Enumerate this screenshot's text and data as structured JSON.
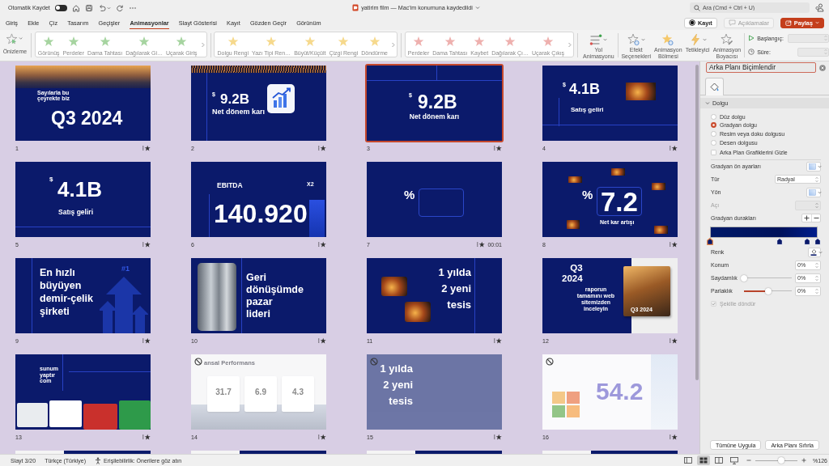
{
  "title_bar": {
    "autosave_label": "Otomatik Kaydet",
    "autosave_on": false,
    "document_title": "yatirim film — Mac'im konumuna kaydedildi",
    "search": {
      "placeholder": "Ara (Cmd + Ctrl + U)"
    }
  },
  "tabs": [
    {
      "label": "Giriş",
      "selected": false
    },
    {
      "label": "Ekle",
      "selected": false
    },
    {
      "label": "Çiz",
      "selected": false
    },
    {
      "label": "Tasarım",
      "selected": false
    },
    {
      "label": "Geçişler",
      "selected": false
    },
    {
      "label": "Animasyonlar",
      "selected": true
    },
    {
      "label": "Slayt Gösterisi",
      "selected": false
    },
    {
      "label": "Kayıt",
      "selected": false
    },
    {
      "label": "Gözden Geçir",
      "selected": false
    },
    {
      "label": "Görünüm",
      "selected": false
    }
  ],
  "header_buttons": [
    {
      "kind": "record",
      "label": "Kayıt",
      "disabled": false
    },
    {
      "kind": "comments",
      "label": "Açıklamalar",
      "disabled": true
    },
    {
      "kind": "share",
      "label": "Paylaş",
      "disabled": false
    }
  ],
  "ribbon": {
    "preview": {
      "label": "Önizleme"
    },
    "galleries": [
      {
        "kind": "entrance",
        "disabled": true,
        "items": [
          "Görünüş",
          "Perdeler",
          "Dama Tahtası",
          "Dağılarak Gi…",
          "Uçarak Giriş"
        ]
      },
      {
        "kind": "emphasis",
        "disabled": true,
        "items": [
          "Dolgu Rengi",
          "Yazı Tipi Ren…",
          "Büyüt/Küçült",
          "Çizgi Rengi",
          "Döndürme"
        ]
      },
      {
        "kind": "exit",
        "disabled": true,
        "items": [
          "Perdeler",
          "Dama Tahtası",
          "Kaybet",
          "Dağılarak Çı…",
          "Uçarak Çıkış"
        ]
      }
    ],
    "tools": [
      {
        "kind": "path",
        "label": "Yol Animasyonu",
        "has_menu": true
      },
      {
        "kind": "effects",
        "label": "Efekt Seçenekleri",
        "has_menu": true
      },
      {
        "kind": "pane",
        "label": "Animasyon Bölmesi",
        "has_menu": false
      },
      {
        "kind": "trigger",
        "label": "Tetikleyici",
        "has_menu": true
      },
      {
        "kind": "painter",
        "label": "Animasyon Boyacısı",
        "has_menu": false
      }
    ],
    "timing": [
      {
        "kind": "start",
        "label": "Başlangıç:"
      },
      {
        "kind": "duration",
        "label": "Süre:"
      }
    ]
  },
  "slides": [
    {
      "number": "1",
      "kind": "cover",
      "selected": false,
      "hidden": false,
      "animated": true,
      "subtitle": "Sayılarla bu çeyrekte biz",
      "title": "Q3 2024"
    },
    {
      "number": "2",
      "kind": "stat-image",
      "selected": false,
      "hidden": false,
      "animated": true,
      "currency": "$",
      "value": "9.2B",
      "caption": "Net dönem karı"
    },
    {
      "number": "3",
      "kind": "stat-center",
      "selected": true,
      "hidden": false,
      "animated": true,
      "currency": "$",
      "value": "9.2B",
      "caption": "Net dönem karı"
    },
    {
      "number": "4",
      "kind": "stat-photo",
      "selected": false,
      "hidden": false,
      "animated": true,
      "currency": "$",
      "value": "4.1B",
      "caption": "Satış geliri"
    },
    {
      "number": "5",
      "kind": "stat-large",
      "selected": false,
      "hidden": false,
      "animated": true,
      "currency": "$",
      "value": "4.1B",
      "caption": "Satış geliri"
    },
    {
      "number": "6",
      "kind": "ebitda",
      "selected": false,
      "hidden": false,
      "animated": true,
      "label": "EBITDA",
      "value": "140.920",
      "badge": "X2"
    },
    {
      "number": "7",
      "kind": "percent-blank",
      "selected": false,
      "hidden": false,
      "animated": true,
      "symbol": "%",
      "timing": "00:01"
    },
    {
      "number": "8",
      "kind": "percent",
      "selected": false,
      "hidden": false,
      "animated": true,
      "symbol": "%",
      "value": "7.2",
      "caption": "Net kar artışı"
    },
    {
      "number": "9",
      "kind": "headline-arrows",
      "selected": false,
      "hidden": false,
      "animated": true,
      "title": "En hızlı büyüyen demir-çelik şirketi",
      "badge": "#1"
    },
    {
      "number": "10",
      "kind": "headline-photo",
      "selected": false,
      "hidden": false,
      "animated": true,
      "title": "Geri dönüşümde pazar lideri"
    },
    {
      "number": "11",
      "kind": "facilities",
      "selected": false,
      "hidden": false,
      "animated": true,
      "title": "1 yılda 2 yeni tesis"
    },
    {
      "number": "12",
      "kind": "report",
      "selected": false,
      "hidden": false,
      "animated": true,
      "title": "Q3 2024",
      "text": "raporun tamamını web sitemizden inceleyin",
      "cover_title": "Q3 2024"
    },
    {
      "number": "13",
      "kind": "contact",
      "selected": false,
      "hidden": false,
      "animated": true,
      "logo": "sunum yaptır com"
    },
    {
      "number": "14",
      "kind": "performance",
      "selected": false,
      "hidden": true,
      "animated": true,
      "title": "ansal Performans",
      "cards": [
        "31.7",
        "6.9",
        "4.3"
      ]
    },
    {
      "number": "15",
      "kind": "facilities-plain",
      "selected": false,
      "hidden": true,
      "animated": true,
      "title": "1 yılda 2 yeni tesis"
    },
    {
      "number": "16",
      "kind": "sustainability",
      "selected": false,
      "hidden": true,
      "animated": true,
      "value": "54.2"
    },
    {
      "kind": "split"
    },
    {
      "kind": "split"
    },
    {
      "kind": "split"
    },
    {
      "kind": "split"
    }
  ],
  "format_pane": {
    "title": "Arka Planı Biçimlendir",
    "tabs": [
      {
        "kind": "fill",
        "selected": true
      }
    ],
    "section": {
      "label": "Dolgu",
      "expanded": true
    },
    "fill_options": [
      {
        "label": "Düz dolgu",
        "selected": false
      },
      {
        "label": "Gradyan dolgu",
        "selected": true
      },
      {
        "label": "Resim veya doku dolgusu",
        "selected": false
      },
      {
        "label": "Desen dolgusu",
        "selected": false
      }
    ],
    "hide_graphics": {
      "label": "Arka Plan Grafiklerini Gizle",
      "checked": false
    },
    "rows": [
      {
        "kind": "swatch",
        "label": "Gradyan ön ayarları",
        "disabled": false
      },
      {
        "kind": "select",
        "label": "Tür",
        "value": "Radyal",
        "disabled": false
      },
      {
        "kind": "swatch",
        "label": "Yön",
        "disabled": false
      },
      {
        "kind": "spinner",
        "label": "Açı",
        "disabled": true
      },
      {
        "kind": "stops",
        "label": "Gradyan durakları",
        "disabled": false
      }
    ],
    "stops": [
      {
        "level": 0,
        "selected": true
      },
      {
        "level": 0.65,
        "selected": false
      },
      {
        "level": 0.9,
        "selected": false
      },
      {
        "level": 1,
        "selected": false
      }
    ],
    "stop_rows": [
      {
        "kind": "color",
        "label": "Renk"
      },
      {
        "kind": "spinner",
        "label": "Konum",
        "value": "0%"
      },
      {
        "kind": "slider",
        "label": "Saydamlık",
        "level": 0,
        "value": "0%"
      },
      {
        "kind": "slider",
        "label": "Parlaklık",
        "level": 0.5,
        "value": "0%"
      }
    ],
    "rotate": {
      "label": "Şekille döndür",
      "checked": true,
      "disabled": true
    },
    "buttons": [
      "Tümüne Uygula",
      "Arka Planı Sıfırla"
    ]
  },
  "status_bar": {
    "slide_info": "Slayt 3/20",
    "language": "Türkçe (Türkiye)",
    "accessibility": "Erişilebilirlik: Önerilere göz atın",
    "views": [
      {
        "kind": "normal",
        "selected": false
      },
      {
        "kind": "sorter",
        "selected": true
      },
      {
        "kind": "reading",
        "selected": false
      },
      {
        "kind": "presenter",
        "selected": false
      }
    ],
    "zoom": {
      "level": 0.62,
      "value": "%126"
    }
  }
}
